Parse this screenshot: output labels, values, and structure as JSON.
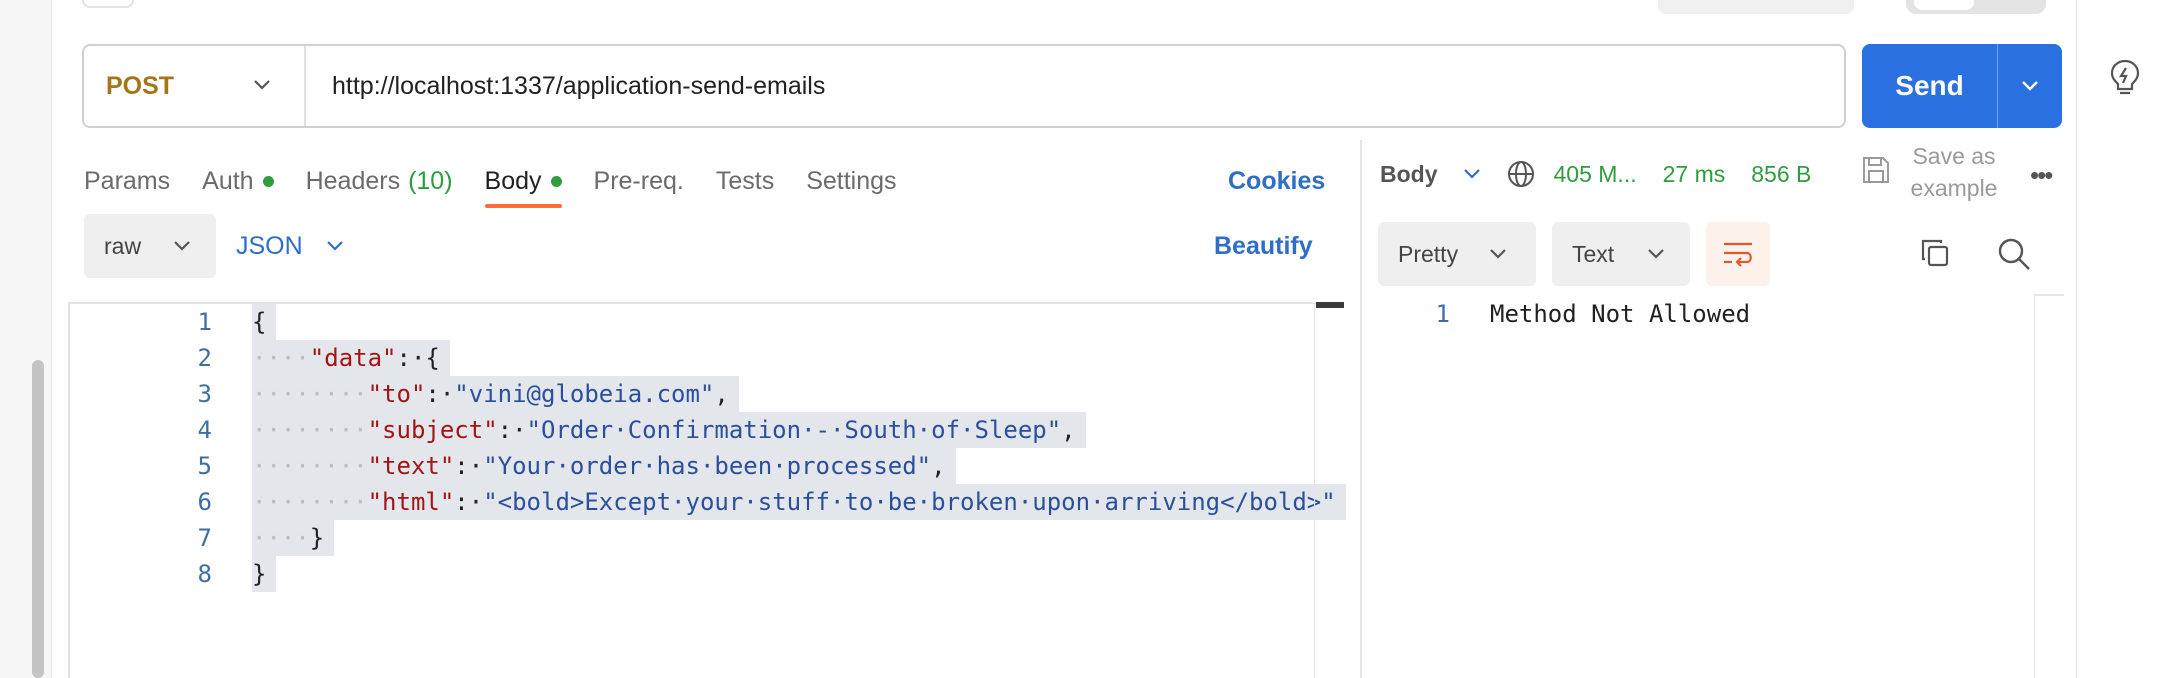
{
  "request": {
    "method": "POST",
    "url": "http://localhost:1337/application-send-emails",
    "send_label": "Send"
  },
  "tabs": [
    {
      "label": "Params"
    },
    {
      "label": "Auth",
      "dot": true
    },
    {
      "label": "Headers",
      "count": "(10)"
    },
    {
      "label": "Body",
      "dot": true,
      "active": true
    },
    {
      "label": "Pre-req."
    },
    {
      "label": "Tests"
    },
    {
      "label": "Settings"
    }
  ],
  "cookies_label": "Cookies",
  "body_options": {
    "mode": "raw",
    "language": "JSON",
    "beautify_label": "Beautify"
  },
  "editor": {
    "line_numbers": [
      "1",
      "2",
      "3",
      "4",
      "5",
      "6",
      "7",
      "8"
    ],
    "lines": [
      [
        {
          "t": "{",
          "c": "p"
        }
      ],
      [
        {
          "t": "····",
          "c": "ws"
        },
        {
          "t": "\"data\"",
          "c": "k"
        },
        {
          "t": ":·",
          "c": "p"
        },
        {
          "t": "{",
          "c": "p"
        }
      ],
      [
        {
          "t": "········",
          "c": "ws"
        },
        {
          "t": "\"to\"",
          "c": "k"
        },
        {
          "t": ":·",
          "c": "p"
        },
        {
          "t": "\"vini@globeia.com\"",
          "c": "s"
        },
        {
          "t": ",",
          "c": "p"
        }
      ],
      [
        {
          "t": "········",
          "c": "ws"
        },
        {
          "t": "\"subject\"",
          "c": "k"
        },
        {
          "t": ":·",
          "c": "p"
        },
        {
          "t": "\"Order·Confirmation·-·South·of·Sleep\"",
          "c": "s"
        },
        {
          "t": ",",
          "c": "p"
        }
      ],
      [
        {
          "t": "········",
          "c": "ws"
        },
        {
          "t": "\"text\"",
          "c": "k"
        },
        {
          "t": ":·",
          "c": "p"
        },
        {
          "t": "\"Your·order·has·been·processed\"",
          "c": "s"
        },
        {
          "t": ",",
          "c": "p"
        }
      ],
      [
        {
          "t": "········",
          "c": "ws"
        },
        {
          "t": "\"html\"",
          "c": "k"
        },
        {
          "t": ":·",
          "c": "p"
        },
        {
          "t": "\"<bold>Except·your·stuff·to·be·broken·upon·arriving</bold>\"",
          "c": "s"
        }
      ],
      [
        {
          "t": "····",
          "c": "ws"
        },
        {
          "t": "}",
          "c": "p"
        }
      ],
      [
        {
          "t": "}",
          "c": "p"
        }
      ]
    ]
  },
  "response": {
    "view_label": "Body",
    "status": "405 M...",
    "time": "27 ms",
    "size": "856 B",
    "save_example_line1": "Save as",
    "save_example_line2": "example",
    "more": "•••",
    "format": "Pretty",
    "type": "Text",
    "line_number": "1",
    "body_text": "Method Not Allowed"
  },
  "colors": {
    "accent": "#2b70e0",
    "method_post": "#a8741a",
    "success": "#2f9c3e",
    "active_tab": "#ff6c37"
  }
}
